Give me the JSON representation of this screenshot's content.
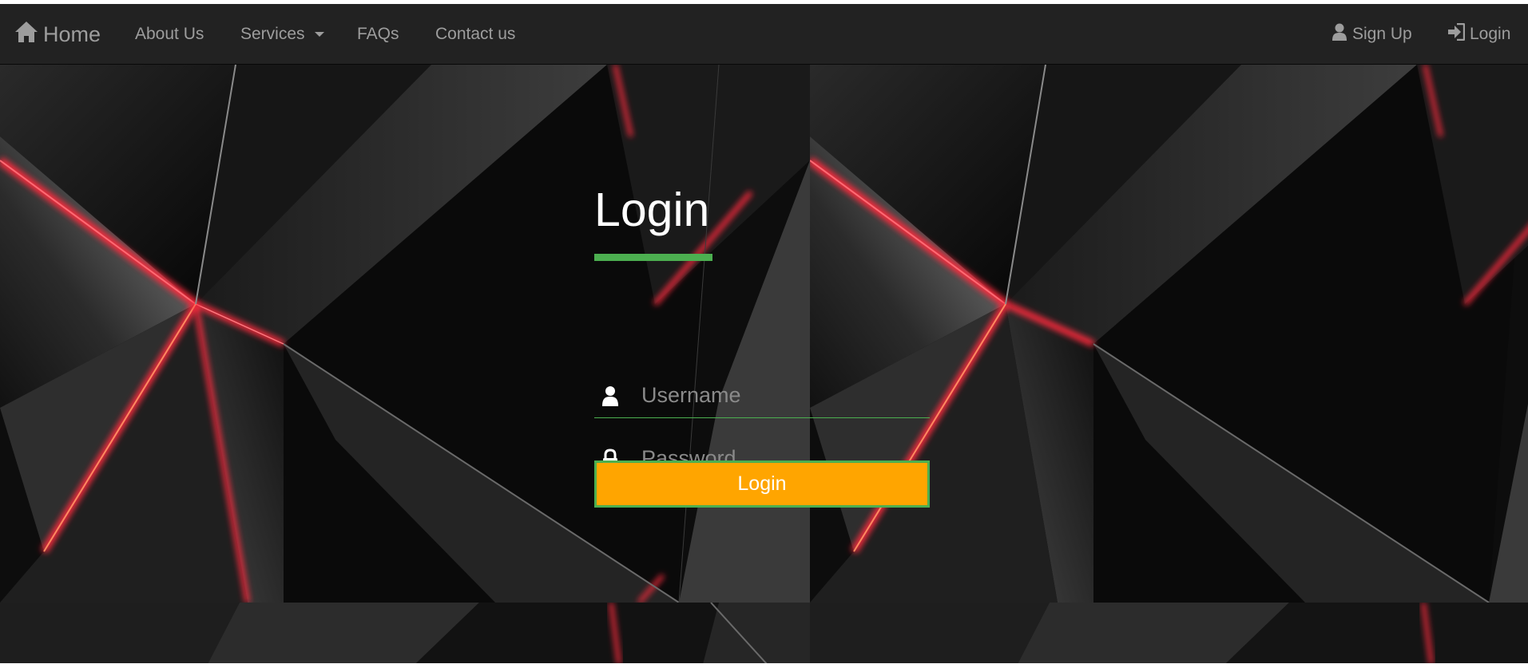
{
  "navbar": {
    "brand": {
      "icon": "home-icon",
      "label": "Home"
    },
    "links": [
      {
        "label": "About Us"
      },
      {
        "label": "Services",
        "icon": "caret-down-icon"
      },
      {
        "label": "FAQs"
      },
      {
        "label": "Contact us"
      }
    ],
    "right_links": [
      {
        "icon": "user-icon",
        "label": "Sign Up"
      },
      {
        "icon": "login-icon",
        "label": "Login"
      }
    ]
  },
  "login": {
    "title": "Login",
    "username": {
      "icon": "user-icon",
      "placeholder": "Username",
      "value": ""
    },
    "password": {
      "icon": "lock-icon",
      "placeholder": "Password",
      "value": ""
    },
    "submit_label": "Login"
  },
  "colors": {
    "navbar_bg": "#222222",
    "nav_text": "#9d9d9d",
    "accent_green": "#4caf50",
    "button_orange": "#ffa500",
    "background_red_glow": "#ff2a3c"
  }
}
